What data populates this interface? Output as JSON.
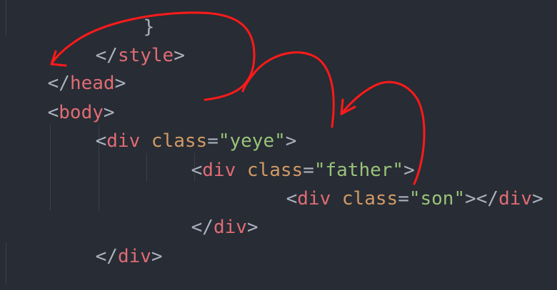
{
  "code": {
    "l0_brace": "}",
    "l1_open": "</",
    "l1_tag": "style",
    "l1_close": ">",
    "l2_open": "</",
    "l2_tag": "head",
    "l2_close": ">",
    "l3_open": "<",
    "l3_tag": "body",
    "l3_close": ">",
    "l4_open": "<",
    "l4_tag": "div",
    "l4_attr": "class",
    "l4_eq": "=",
    "l4_val": "\"yeye\"",
    "l4_close": ">",
    "l5_open": "<",
    "l5_tag": "div",
    "l5_attr": "class",
    "l5_eq": "=",
    "l5_val": "\"father\"",
    "l5_close": ">",
    "l6_open": "<",
    "l6_tag": "div",
    "l6_attr": "class",
    "l6_eq": "=",
    "l6_val": "\"son\"",
    "l6_close": "></",
    "l6_tag2": "div",
    "l6_close2": ">",
    "l7_open": "</",
    "l7_tag": "div",
    "l7_close": ">",
    "l8_open": "</",
    "l8_tag": "div",
    "l8_close": ">"
  },
  "colors": {
    "background": "#282c34",
    "tag": "#e06c75",
    "attribute": "#d19a66",
    "string": "#98c379",
    "punctuation": "#abb2bf",
    "annotation": "#ff1a1a"
  },
  "annotation": {
    "icon": "hand-drawn-red-arrows"
  }
}
